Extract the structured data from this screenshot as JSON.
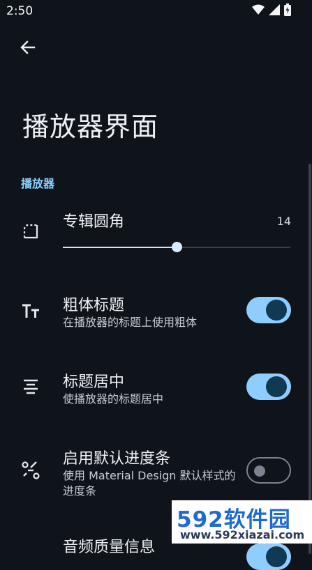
{
  "status_bar": {
    "time": "2:50",
    "icons": [
      "wifi-icon",
      "signal-icon",
      "battery-icon"
    ]
  },
  "header": {
    "back_icon": "arrow-left-icon",
    "title": "播放器界面"
  },
  "section": {
    "label": "播放器"
  },
  "rows": {
    "album_corner": {
      "icon": "rounded-corner-icon",
      "title": "专辑圆角",
      "value": "14",
      "slider_fraction": 0.5
    },
    "bold_title": {
      "icon": "text-size-icon",
      "title": "粗体标题",
      "subtitle": "在播放器的标题上使用粗体",
      "enabled": true
    },
    "center_title": {
      "icon": "align-center-icon",
      "title": "标题居中",
      "subtitle": "使播放器的标题居中",
      "enabled": true
    },
    "default_progress": {
      "icon": "route-icon",
      "title": "启用默认进度条",
      "subtitle": "使用 Material Design 默认样式的进度条",
      "enabled": false
    },
    "audio_quality": {
      "title": "音频质量信息",
      "enabled": true
    }
  },
  "colors": {
    "background": "#0f141a",
    "accent": "#8fcdff",
    "section_text": "#8fd0ff"
  },
  "watermark": {
    "big": "592软件园",
    "small": "www.592xiazai.com"
  }
}
